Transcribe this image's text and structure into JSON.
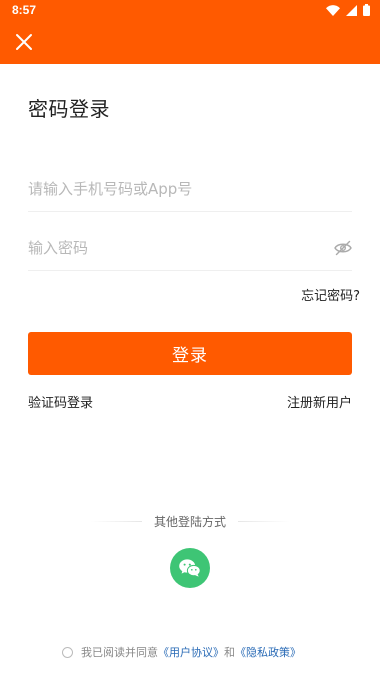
{
  "status_bar": {
    "time": "8:57"
  },
  "toolbar": {
    "close_icon": "close-icon"
  },
  "page": {
    "title": "密码登录"
  },
  "form": {
    "phone_placeholder": "请输入手机号码或App号",
    "password_placeholder": "输入密码",
    "password_toggle_icon": "eye-off-icon",
    "forgot_password": "忘记密码?",
    "login_button": "登录"
  },
  "links": {
    "sms_login": "验证码登录",
    "register": "注册新用户"
  },
  "other_login": {
    "label": "其他登陆方式",
    "wechat_icon": "wechat-icon"
  },
  "agreement": {
    "prefix": "我已阅读并同意",
    "user_agreement": "《用户协议》",
    "conjunction": "和",
    "privacy_policy": "《隐私政策》",
    "checked": false
  },
  "colors": {
    "brand": "#ff5a00",
    "wechat": "#3ec575",
    "link": "#2a6bb6"
  }
}
